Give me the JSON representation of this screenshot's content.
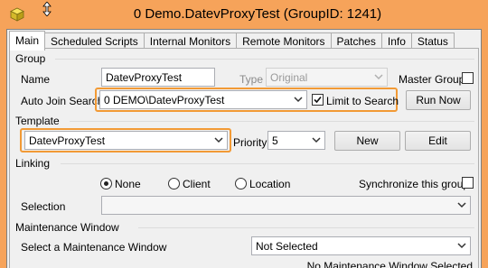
{
  "window": {
    "title": "0 Demo.DatevProxyTest   (GroupID: 1241)"
  },
  "tabs": [
    {
      "label": "Main",
      "active": true
    },
    {
      "label": "Scheduled Scripts"
    },
    {
      "label": "Internal Monitors"
    },
    {
      "label": "Remote Monitors"
    },
    {
      "label": "Patches"
    },
    {
      "label": "Info"
    },
    {
      "label": "Status"
    }
  ],
  "group": {
    "section_label": "Group",
    "name_label": "Name",
    "name_value": "DatevProxyTest",
    "type_label": "Type",
    "type_value": "Original",
    "master_group_label": "Master Group",
    "auto_join_label": "Auto Join Search",
    "auto_join_value": "0 DEMO\\DatevProxyTest",
    "limit_to_search_label": "Limit to Search",
    "limit_to_search_checked": true,
    "run_now_label": "Run Now"
  },
  "template": {
    "section_label": "Template",
    "template_value": "DatevProxyTest",
    "priority_label": "Priority",
    "priority_value": "5",
    "new_label": "New",
    "edit_label": "Edit"
  },
  "linking": {
    "section_label": "Linking",
    "options": [
      "None",
      "Client",
      "Location"
    ],
    "selected": "None",
    "sync_label": "Synchronize this group",
    "selection_label": "Selection",
    "selection_value": ""
  },
  "maintenance": {
    "section_label": "Maintenance Window",
    "select_label": "Select a Maintenance Window",
    "select_value": "Not Selected",
    "status_text": "No Maintenance Window Selected"
  },
  "colors": {
    "title_bar": "#f6a35a",
    "highlight": "#f29a35"
  }
}
